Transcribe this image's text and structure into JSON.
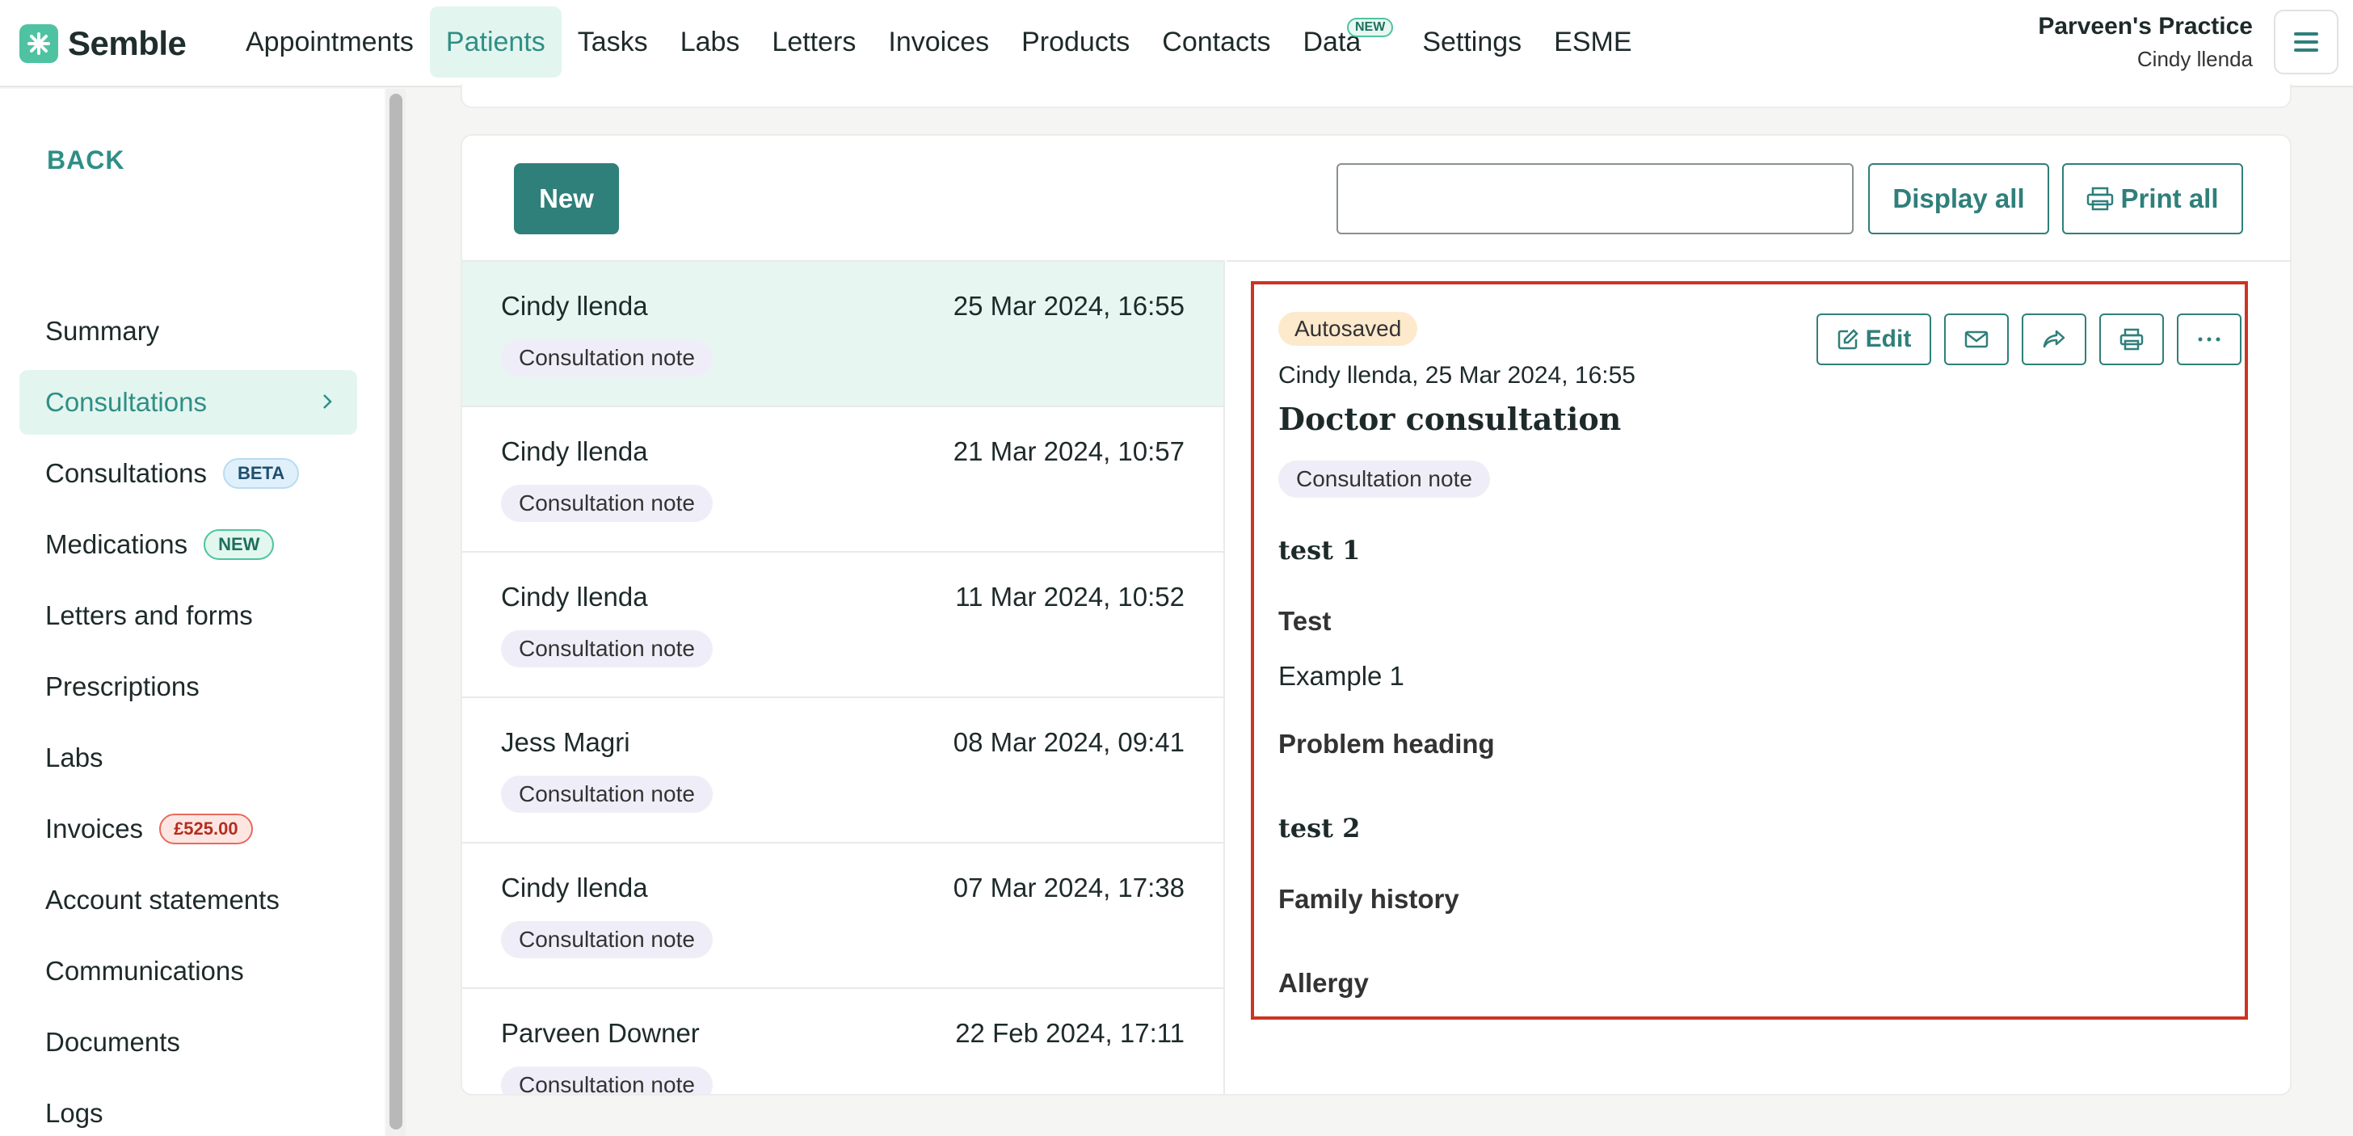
{
  "app": {
    "brand": "Semble"
  },
  "nav": {
    "items": [
      {
        "label": "Appointments"
      },
      {
        "label": "Patients",
        "active": true
      },
      {
        "label": "Tasks"
      },
      {
        "label": "Labs"
      },
      {
        "label": "Letters"
      },
      {
        "label": "Invoices"
      },
      {
        "label": "Products"
      },
      {
        "label": "Contacts"
      },
      {
        "label": "Data",
        "badge": "NEW"
      },
      {
        "label": "Settings"
      },
      {
        "label": "ESME"
      }
    ]
  },
  "practice": {
    "name": "Parveen's Practice",
    "user": "Cindy llenda"
  },
  "sidebar": {
    "back_label": "BACK",
    "items": [
      {
        "label": "Summary"
      },
      {
        "label": "Consultations",
        "active": true
      },
      {
        "label": "Consultations",
        "badge": "BETA"
      },
      {
        "label": "Medications",
        "badge": "NEW"
      },
      {
        "label": "Letters and forms"
      },
      {
        "label": "Prescriptions"
      },
      {
        "label": "Labs"
      },
      {
        "label": "Invoices",
        "badge": "£525.00"
      },
      {
        "label": "Account statements"
      },
      {
        "label": "Communications"
      },
      {
        "label": "Documents"
      },
      {
        "label": "Logs"
      }
    ]
  },
  "toolbar": {
    "new_label": "New",
    "search_value": "",
    "display_all_label": "Display all",
    "print_all_label": "Print all"
  },
  "consultations": [
    {
      "author": "Cindy llenda",
      "date": "25 Mar 2024, 16:55",
      "tag": "Consultation note",
      "selected": true
    },
    {
      "author": "Cindy llenda",
      "date": "21 Mar 2024, 10:57",
      "tag": "Consultation note"
    },
    {
      "author": "Cindy llenda",
      "date": "11 Mar 2024, 10:52",
      "tag": "Consultation note"
    },
    {
      "author": "Jess Magri",
      "date": "08 Mar 2024, 09:41",
      "tag": "Consultation note"
    },
    {
      "author": "Cindy llenda",
      "date": "07 Mar 2024, 17:38",
      "tag": "Consultation note"
    },
    {
      "author": "Parveen Downer",
      "date": "22 Feb 2024, 17:11",
      "tag": "Consultation note"
    }
  ],
  "detail": {
    "status": "Autosaved",
    "meta": "Cindy llenda, 25 Mar 2024, 16:55",
    "title": "Doctor consultation",
    "tag": "Consultation note",
    "edit_label": "Edit",
    "sections": [
      {
        "text": "test 1",
        "style": "serif"
      },
      {
        "text": "Test",
        "style": "bold"
      },
      {
        "text": "Example 1",
        "style": "plain"
      },
      {
        "text": "Problem heading",
        "style": "bold"
      },
      {
        "text": "test 2",
        "style": "serif"
      },
      {
        "text": "Family history",
        "style": "bold"
      },
      {
        "text": "Allergy",
        "style": "bold"
      }
    ]
  },
  "colors": {
    "accent": "#2f7f7a",
    "highlight": "#cc3322",
    "selected_row": "#e8f6f1"
  }
}
